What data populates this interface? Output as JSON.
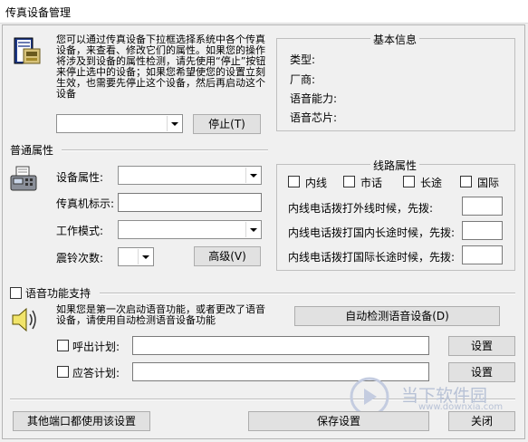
{
  "window": {
    "title": "传真设备管理"
  },
  "top": {
    "description": "您可以通过传真设备下拉框选择系统中各个传真设备，来查看、修改它们的属性。如果您的操作将涉及到设备的属性检测，请先使用“停止”按钮来停止选中的设备；如果您希望使您的设置立刻生效，也需要先停止这个设备，然后再启动这个设备",
    "device_select_value": "",
    "stop_button": "停止(T)"
  },
  "basic_info": {
    "title": "基本信息",
    "type_label": "类型:",
    "vendor_label": "厂商:",
    "voice_label": "语音能力:",
    "chip_label": "语音芯片:"
  },
  "general": {
    "section_label": "普通属性",
    "device_props_label": "设备属性:",
    "device_props_value": "",
    "fax_id_label": "传真机标示:",
    "fax_id_value": "",
    "work_mode_label": "工作模式:",
    "work_mode_value": "",
    "rings_label": "震铃次数:",
    "rings_value": "",
    "advanced_button": "高级(V)"
  },
  "line_props": {
    "title": "线路属性",
    "local": "内线",
    "city": "市话",
    "long_distance": "长途",
    "international": "国际",
    "outside_prefix_label": "内线电话拨打外线时候，先拨:",
    "domestic_prefix_label": "内线电话拨打国内长途时候，先拨:",
    "intl_prefix_label": "内线电话拨打国际长途时候，先拨:",
    "outside_prefix_value": "",
    "domestic_prefix_value": "",
    "intl_prefix_value": ""
  },
  "voice": {
    "support_label": "语音功能支持",
    "description": "如果您是第一次启动语音功能，或者更改了语音设备，请使用自动检测语音设备功能",
    "auto_detect_button": "自动检测语音设备(D)",
    "outgoing_label": "呼出计划:",
    "outgoing_value": "",
    "answer_label": "应答计划:",
    "answer_value": "",
    "setup_button": "设置"
  },
  "footer": {
    "other_port_button": "其他端口都使用该设置",
    "save_button": "保存设置",
    "close_button": "关闭"
  },
  "watermark": {
    "brand": "当下软件园",
    "url": "www.downxia.com"
  }
}
